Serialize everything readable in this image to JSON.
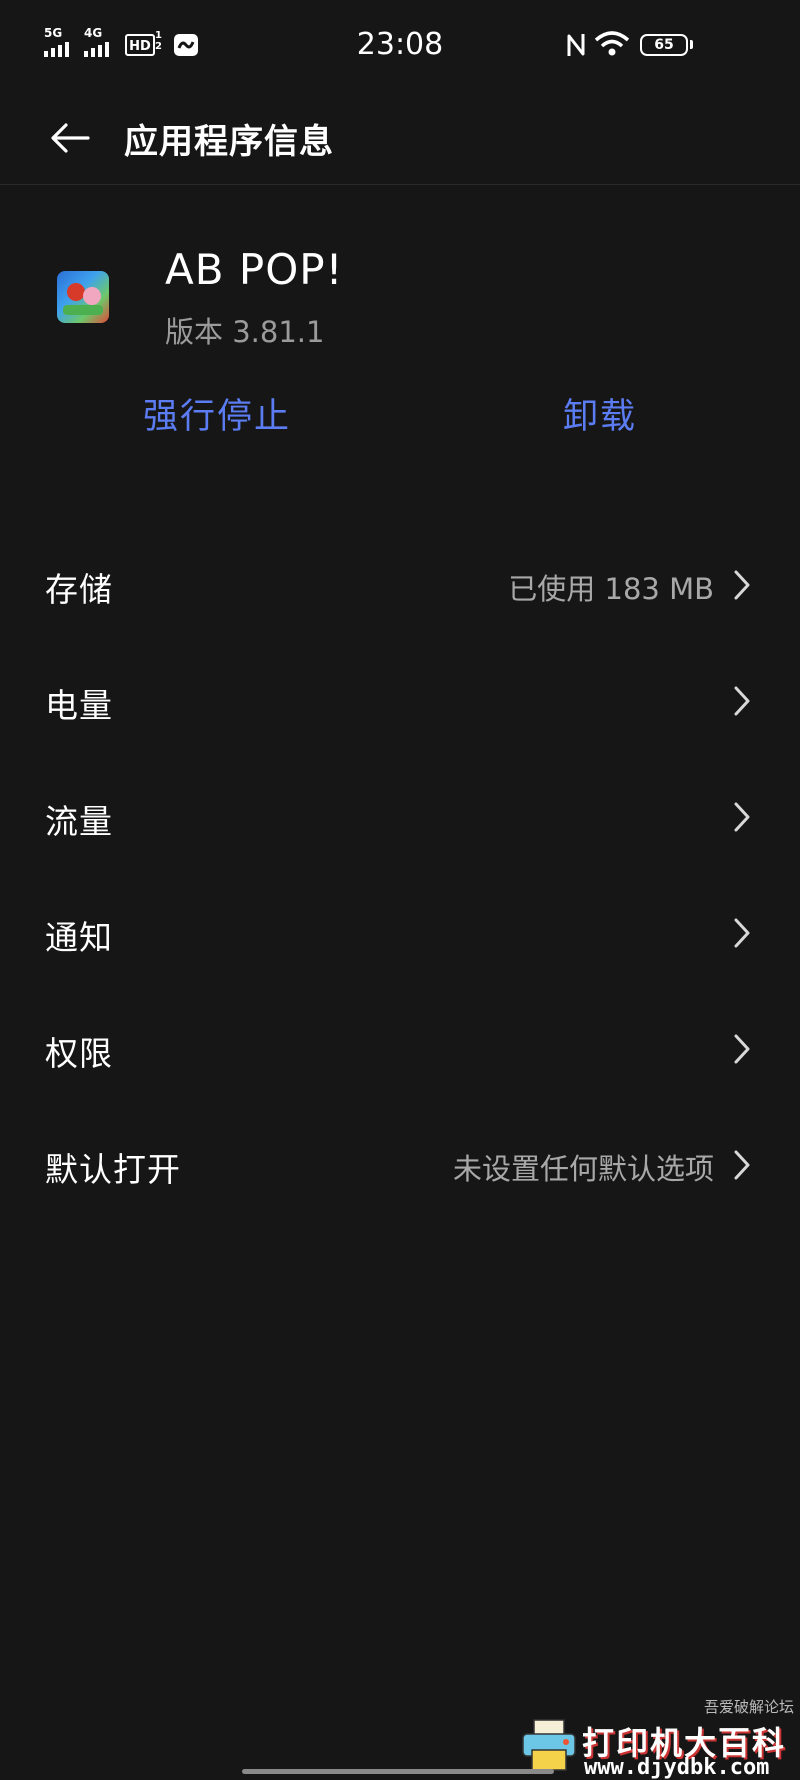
{
  "status_bar": {
    "signal_1_label": "5G",
    "signal_2_label": "4G",
    "hd_label": "HD",
    "hd_sub_top": "1",
    "hd_sub_bottom": "2",
    "time": "23:08",
    "battery_level": "65"
  },
  "header": {
    "title": "应用程序信息",
    "back_icon": "arrow-left-icon"
  },
  "app": {
    "name": "AB POP!",
    "version": "版本 3.81.1"
  },
  "actions": {
    "force_stop": "强行停止",
    "uninstall": "卸载",
    "accent_color": "#5b7cf2"
  },
  "settings": [
    {
      "label": "存储",
      "value": "已使用 183 MB"
    },
    {
      "label": "电量",
      "value": ""
    },
    {
      "label": "流量",
      "value": ""
    },
    {
      "label": "通知",
      "value": ""
    },
    {
      "label": "权限",
      "value": ""
    },
    {
      "label": "默认打开",
      "value": "未设置任何默认选项"
    }
  ],
  "watermark": {
    "title": "打印机大百科",
    "url": "www.djydbk.com",
    "forum": "吾爱破解论坛"
  }
}
